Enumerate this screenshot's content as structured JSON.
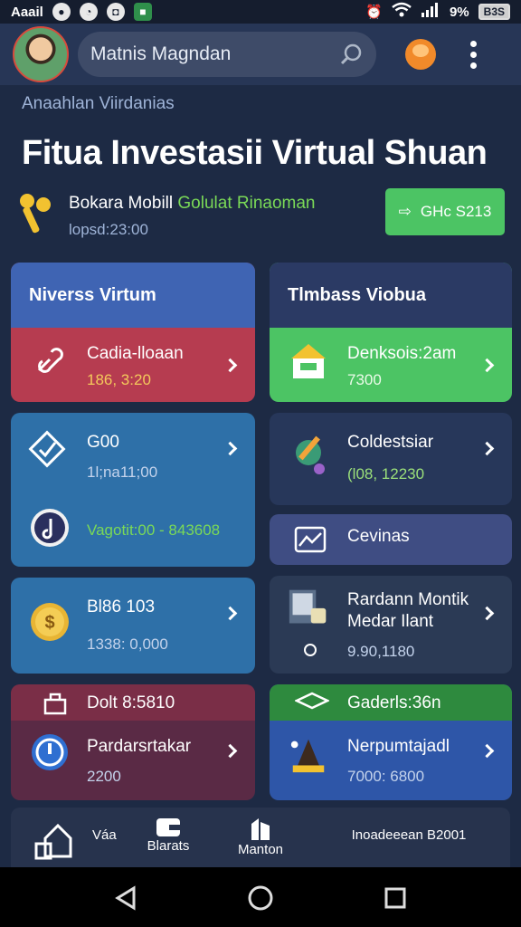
{
  "status_bar": {
    "carrier": "Aaail",
    "battery": "9%",
    "battery_label": "B3S",
    "icons": [
      "whatsapp-icon",
      "messenger-icon",
      "app-icon",
      "alarm-icon",
      "wifi-icon",
      "signal-icon",
      "battery-icon"
    ]
  },
  "app_bar": {
    "search_text": "Matnis Magndan",
    "icons": [
      "avatar",
      "search-icon",
      "profile-icon",
      "menu-icon"
    ]
  },
  "subtitle": "Anaahlan Viirdanias",
  "headline": "Fitua Investasii  Virtual  Shuan",
  "promo": {
    "title_part1": "Bokara Mobill ",
    "title_part2": "Golulat Rinaoman",
    "time": "lopsd:23:00",
    "button_label": "GHc S213",
    "colors": {
      "accent": "#4cc464"
    }
  },
  "left_column": {
    "section_title": "Niverss Virtum",
    "cards": [
      {
        "title": "Cadia-lloaan",
        "sub": "186, 3:20",
        "icon": "link-icon",
        "color": "#b63c50"
      },
      {
        "title": "G00",
        "sub": "1l;na11;00",
        "icon": "check-badge-icon",
        "color": "#2e70a8"
      },
      {
        "title": "",
        "sub": "Vagotit:00 - 843608",
        "icon": "music-icon",
        "color": "#2e70a8"
      },
      {
        "title": "Bl86 103",
        "sub": "1338: 0,000",
        "icon": "coin-icon",
        "color": "#2e70a8"
      },
      {
        "title": "Dolt 8:5810",
        "sub": "",
        "icon": "bag-icon",
        "color": "#7a2e47"
      },
      {
        "title": "Pardarsrtakar",
        "sub": "2200",
        "icon": "power-icon",
        "color": "#5a2a45"
      }
    ]
  },
  "right_column": {
    "section_title": "Tlmbass Viobua",
    "cards": [
      {
        "title": "Denksois:2am",
        "sub": "7300",
        "icon": "house-icon",
        "color": "#4cc464"
      },
      {
        "title": "Coldestsiar",
        "sub": "(l08, 12230",
        "icon": "pencil-icon",
        "color": "#27375a"
      },
      {
        "title": "Cevinas",
        "sub": "",
        "icon": "chart-icon",
        "color": "#3f4d83"
      },
      {
        "title": "Rardann Montik",
        "title2": "Medar Ilant",
        "sub": "9.90,1180",
        "icon": "notebook-icon",
        "color": "#2b3a55"
      },
      {
        "title": "Gaderls:36n",
        "sub": "",
        "icon": "cash-icon",
        "color": "#2e8a3e"
      },
      {
        "title": "Nerpumtajadl",
        "sub": "7000: 6800",
        "icon": "treasure-icon",
        "color": "#2e56a8"
      }
    ]
  },
  "bottom_nav": {
    "items": [
      {
        "label": "Váa",
        "icon": "home-icon"
      },
      {
        "label": "Blarats",
        "icon": "wallet-icon"
      },
      {
        "label": "Manton",
        "icon": "building-icon"
      },
      {
        "label": "Inoadeeean B2001",
        "icon": ""
      }
    ]
  },
  "system_nav": [
    "back-icon",
    "home-circle-icon",
    "recents-icon"
  ]
}
